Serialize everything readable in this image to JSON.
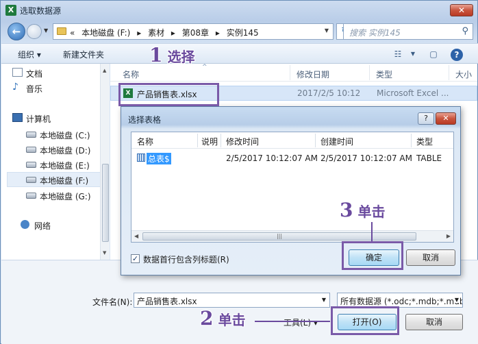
{
  "window": {
    "title": "选取数据源",
    "close_label": "✕"
  },
  "nav": {
    "breadcrumbs": [
      "«",
      "本地磁盘 (F:)",
      "▸",
      "素材",
      "▸",
      "第08章",
      "▸",
      "实例145"
    ],
    "search_placeholder": "搜索 实例145"
  },
  "toolbar": {
    "organize": "组织 ▾",
    "new_folder": "新建文件夹"
  },
  "sidebar": {
    "items": [
      {
        "label": "文档",
        "icon": "document-icon"
      },
      {
        "label": "音乐",
        "icon": "music-icon"
      },
      {
        "label": "计算机",
        "icon": "computer-icon"
      },
      {
        "label": "本地磁盘 (C:)",
        "icon": "drive-icon"
      },
      {
        "label": "本地磁盘 (D:)",
        "icon": "drive-icon"
      },
      {
        "label": "本地磁盘 (E:)",
        "icon": "drive-icon"
      },
      {
        "label": "本地磁盘 (F:)",
        "icon": "drive-icon"
      },
      {
        "label": "本地磁盘 (G:)",
        "icon": "drive-icon"
      },
      {
        "label": "网络",
        "icon": "network-icon"
      }
    ]
  },
  "filelist": {
    "columns": [
      "名称",
      "修改日期",
      "类型",
      "大小"
    ],
    "rows": [
      {
        "name": "产品销售表.xlsx",
        "modified": "2017/2/5 10:12",
        "type": "Microsoft Excel ..."
      }
    ]
  },
  "bottom": {
    "filename_label": "文件名(N):",
    "filename_value": "产品销售表.xlsx",
    "filetype_value": "所有数据源 (*.odc;*.mdb;*.mdb)",
    "tools_label": "工具(L) ▾",
    "open_label": "打开(O)",
    "cancel_label": "取消"
  },
  "dialog": {
    "title": "选择表格",
    "help_label": "?",
    "close_label": "✕",
    "columns": [
      "名称",
      "说明",
      "修改时间",
      "创建时间",
      "类型"
    ],
    "rows": [
      {
        "name": "总表$",
        "description": "",
        "modified": "2/5/2017 10:12:07 AM",
        "created": "2/5/2017 10:12:07 AM",
        "type": "TABLE"
      }
    ],
    "first_row_header_label": "数据首行包含列标题(R)",
    "first_row_header_checked": true,
    "ok_label": "确定",
    "cancel_label": "取消"
  },
  "callouts": [
    {
      "num": "1",
      "text": "选择"
    },
    {
      "num": "2",
      "text": "单击"
    },
    {
      "num": "3",
      "text": "单击"
    }
  ],
  "colors": {
    "callout": "#6a4a9e",
    "selection": "#3399ff",
    "row_highlight": "#d7e6f8"
  }
}
